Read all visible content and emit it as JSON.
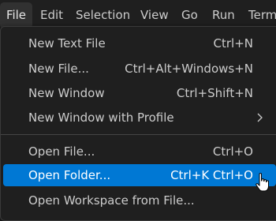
{
  "menubar": {
    "items": [
      "File",
      "Edit",
      "Selection",
      "View",
      "Go",
      "Run",
      "Term"
    ]
  },
  "file_menu": {
    "items": [
      {
        "label": "New Text File",
        "shortcut": "Ctrl+N"
      },
      {
        "label": "New File...",
        "shortcut": "Ctrl+Alt+Windows+N"
      },
      {
        "label": "New Window",
        "shortcut": "Ctrl+Shift+N"
      },
      {
        "label": "New Window with Profile",
        "shortcut": ""
      },
      {
        "label": "Open File...",
        "shortcut": "Ctrl+O"
      },
      {
        "label": "Open Folder...",
        "shortcut": "Ctrl+K Ctrl+O"
      },
      {
        "label": "Open Workspace from File...",
        "shortcut": ""
      }
    ],
    "active_item": "Open Folder...",
    "submenu_icon": "chevron-right-icon"
  },
  "colors": {
    "background": "#1f1f1f",
    "highlight": "#0078d4",
    "text": "#cccccc"
  }
}
